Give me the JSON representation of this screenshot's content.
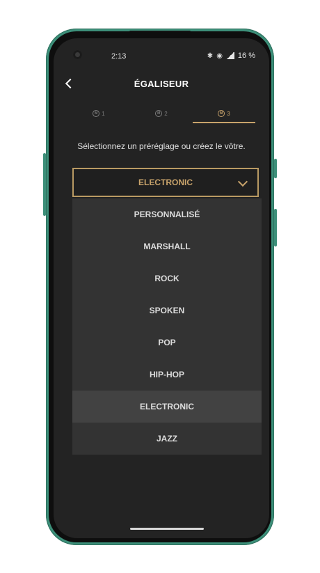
{
  "status": {
    "time": "2:13",
    "battery": "16 %"
  },
  "header": {
    "title": "ÉGALISEUR",
    "back_icon": "back-arrow-icon"
  },
  "tabs": [
    {
      "label": "1",
      "active": false
    },
    {
      "label": "2",
      "active": false
    },
    {
      "label": "3",
      "active": true
    }
  ],
  "prompt": "Sélectionnez un préréglage ou créez le vôtre.",
  "preset_select": {
    "value": "ELECTRONIC"
  },
  "options": [
    {
      "label": "PERSONNALISÉ"
    },
    {
      "label": "MARSHALL"
    },
    {
      "label": "ROCK"
    },
    {
      "label": "SPOKEN"
    },
    {
      "label": "POP"
    },
    {
      "label": "HIP-HOP"
    },
    {
      "label": "ELECTRONIC",
      "selected": true
    },
    {
      "label": "JAZZ"
    }
  ],
  "colors": {
    "accent": "#c8a36b",
    "background": "#232323",
    "menu": "#333333",
    "frame": "#3c8f79"
  }
}
